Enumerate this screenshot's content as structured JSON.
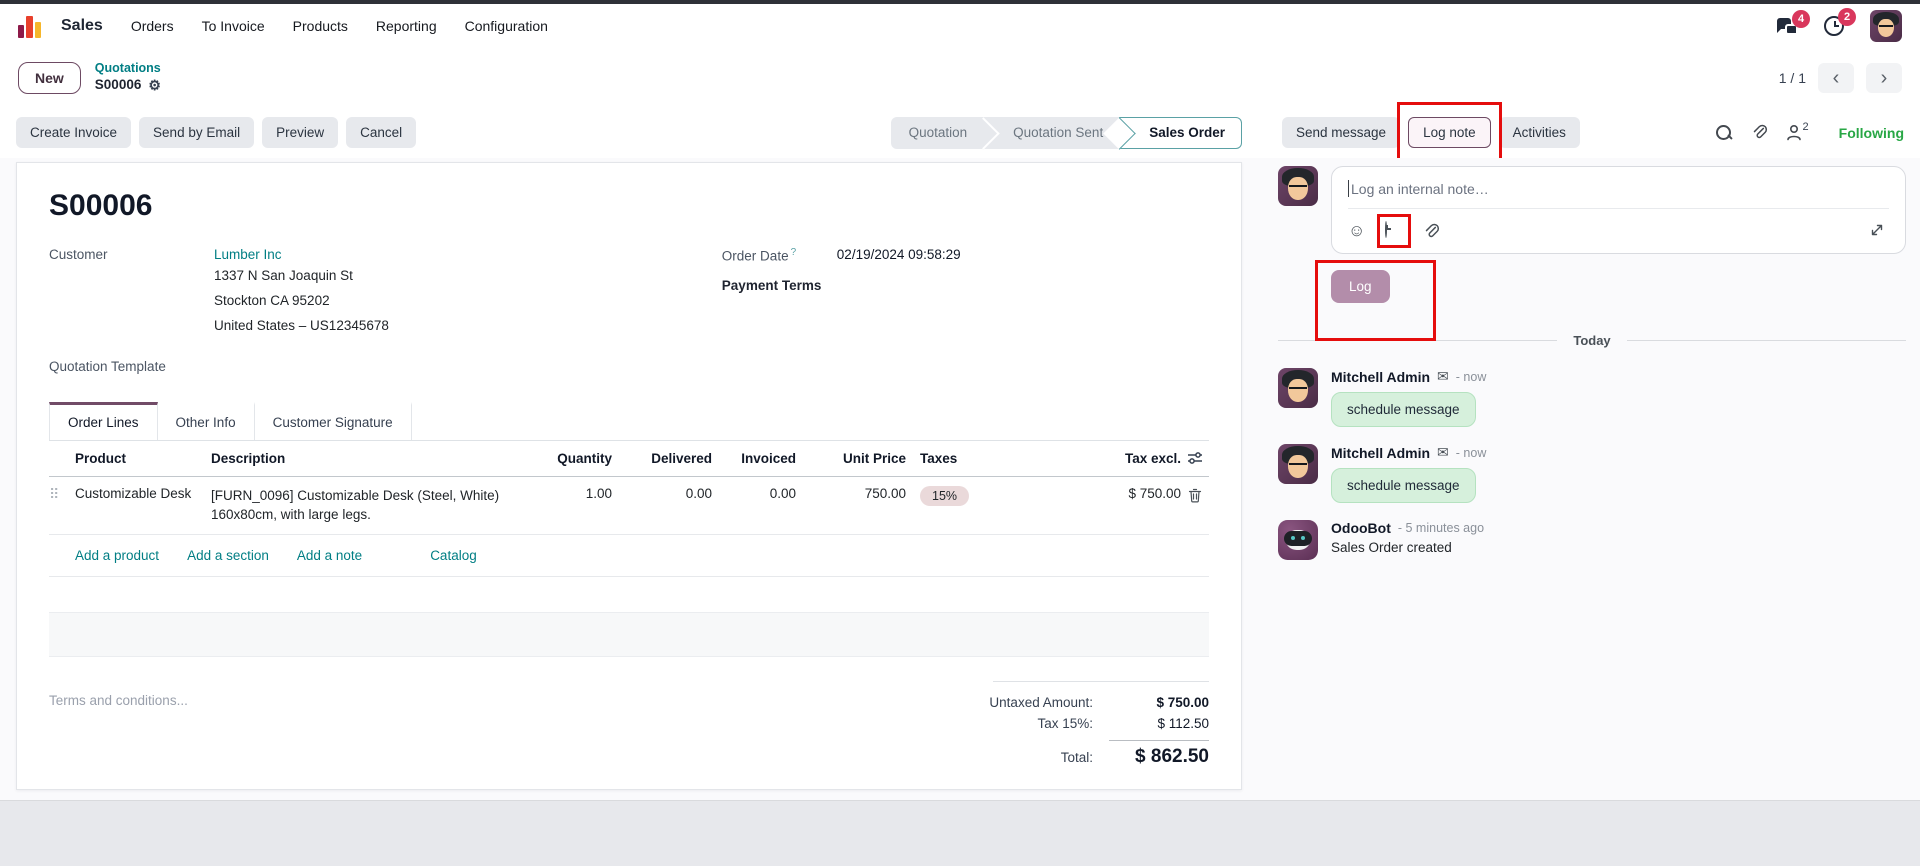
{
  "nav": {
    "app_name": "Sales",
    "items": [
      "Orders",
      "To Invoice",
      "Products",
      "Reporting",
      "Configuration"
    ],
    "messages_badge": "4",
    "activities_badge": "2"
  },
  "breadcrumb": {
    "new_button": "New",
    "parent": "Quotations",
    "current": "S00006",
    "pager": "1 / 1"
  },
  "control_panel": {
    "buttons": [
      "Create Invoice",
      "Send by Email",
      "Preview",
      "Cancel"
    ],
    "statusbar": [
      {
        "label": "Quotation",
        "active": false
      },
      {
        "label": "Quotation Sent",
        "active": false
      },
      {
        "label": "Sales Order",
        "active": true
      }
    ],
    "send_message_label": "Send message",
    "log_note_label": "Log note",
    "activities_label": "Activities",
    "followers_count": "2",
    "following_label": "Following"
  },
  "form": {
    "title": "S00006",
    "customer_label": "Customer",
    "customer_name": "Lumber Inc",
    "customer_address": [
      "1337 N San Joaquin St",
      "Stockton CA 95202",
      "United States – US12345678"
    ],
    "quotation_template_label": "Quotation Template",
    "order_date_label": "Order Date",
    "order_date_help": "?",
    "order_date_value": "02/19/2024 09:58:29",
    "payment_terms_label": "Payment Terms",
    "tabs": [
      {
        "label": "Order Lines",
        "active": true
      },
      {
        "label": "Other Info",
        "active": false
      },
      {
        "label": "Customer Signature",
        "active": false
      }
    ],
    "table": {
      "headers": [
        "Product",
        "Description",
        "Quantity",
        "Delivered",
        "Invoiced",
        "Unit Price",
        "Taxes",
        "Tax excl."
      ],
      "rows": [
        {
          "product": "Customizable Desk",
          "description_line1": "[FURN_0096] Customizable Desk (Steel, White)",
          "description_line2": "160x80cm, with large legs.",
          "quantity": "1.00",
          "delivered": "0.00",
          "invoiced": "0.00",
          "unit_price": "750.00",
          "taxes": "15%",
          "tax_excl": "$ 750.00"
        }
      ],
      "links": [
        "Add a product",
        "Add a section",
        "Add a note",
        "Catalog"
      ]
    },
    "terms_placeholder": "Terms and conditions...",
    "totals": {
      "untaxed_label": "Untaxed Amount:",
      "untaxed_value": "$ 750.00",
      "tax_label": "Tax 15%:",
      "tax_value": "$ 112.50",
      "total_label": "Total:",
      "total_value": "$ 862.50"
    }
  },
  "chatter": {
    "composer_placeholder": "Log an internal note…",
    "log_button": "Log",
    "today_divider": "Today",
    "messages": [
      {
        "author": "Mitchell Admin",
        "time": "- now",
        "body": "schedule message"
      },
      {
        "author": "Mitchell Admin",
        "time": "- now",
        "body": "schedule message"
      },
      {
        "author": "OdooBot",
        "time": "- 5 minutes ago",
        "body": "Sales Order created"
      }
    ]
  },
  "colors": {
    "accent_purple": "#714B67",
    "link_teal": "#017e84",
    "statusbar_active_teal": "#5aa1a5",
    "following_green": "#28a745",
    "annotation_red": "#e50d0d",
    "badge_red": "#d9375c",
    "note_green_bg": "#d6f0dc"
  }
}
